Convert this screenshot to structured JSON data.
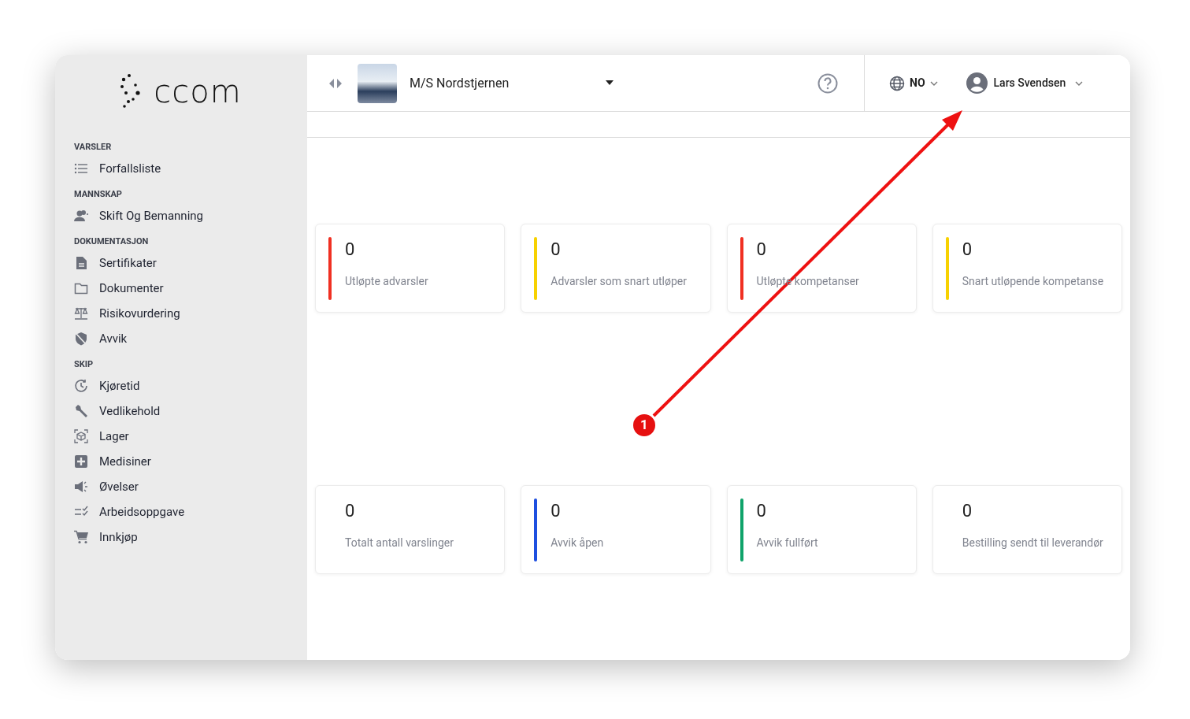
{
  "logo": {
    "text": "ccom"
  },
  "sidebar": {
    "sections": [
      {
        "heading": "VARSLER",
        "items": [
          {
            "label": "Forfallsliste"
          }
        ]
      },
      {
        "heading": "MANNSKAP",
        "items": [
          {
            "label": "Skift Og Bemanning"
          }
        ]
      },
      {
        "heading": "DOKUMENTASJON",
        "items": [
          {
            "label": "Sertifikater"
          },
          {
            "label": "Dokumenter"
          },
          {
            "label": "Risikovurdering"
          },
          {
            "label": "Avvik"
          }
        ]
      },
      {
        "heading": "SKIP",
        "items": [
          {
            "label": "Kjøretid"
          },
          {
            "label": "Vedlikehold"
          },
          {
            "label": "Lager"
          },
          {
            "label": "Medisiner"
          },
          {
            "label": "Øvelser"
          },
          {
            "label": "Arbeidsoppgave"
          },
          {
            "label": "Innkjøp"
          }
        ]
      }
    ]
  },
  "header": {
    "vessel": "M/S Nordstjernen",
    "language": "NO",
    "user": "Lars Svendsen"
  },
  "cards": [
    {
      "value": "0",
      "label": "Utløpte advarsler",
      "color": "#f03022"
    },
    {
      "value": "0",
      "label": "Advarsler som snart utløper",
      "color": "#f7d100"
    },
    {
      "value": "0",
      "label": "Utløpte kompetanser",
      "color": "#f03022"
    },
    {
      "value": "0",
      "label": "Snart utløpende kompetanse",
      "color": "#f7d100"
    },
    {
      "value": "0",
      "label": "Totalt antall varslinger"
    },
    {
      "value": "0",
      "label": "Avvik åpen",
      "color": "#1e4fe0"
    },
    {
      "value": "0",
      "label": "Avvik fullført",
      "color": "#10a36a"
    },
    {
      "value": "0",
      "label": "Bestilling sendt til leverandør"
    }
  ],
  "annotation": {
    "number": "1"
  }
}
